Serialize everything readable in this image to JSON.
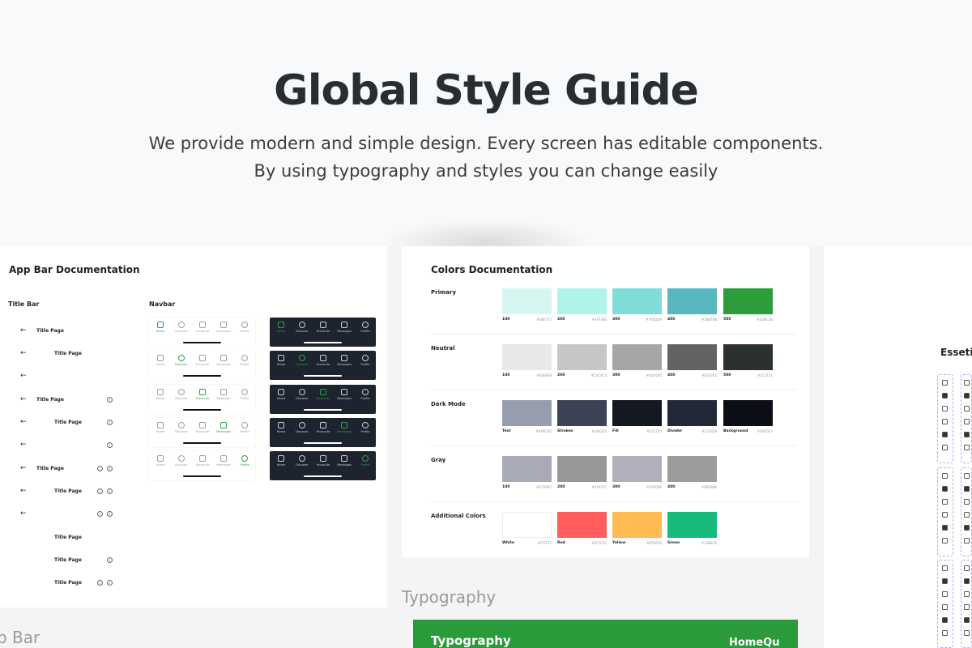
{
  "hero": {
    "title": "Global Style Guide",
    "subtitle_line1": "We provide modern and simple design. Every screen has editable components.",
    "subtitle_line2": "By using typography and styles you can change easily"
  },
  "appbar_panel": {
    "title": "App Bar Documentation",
    "titlebar_heading": "Title Bar",
    "navbar_heading": "Navbar",
    "title_rows": [
      {
        "label": "Title Page",
        "info_count": 0
      },
      {
        "label": "Title Page",
        "info_count": 0
      },
      {
        "label": "",
        "info_count": 0
      },
      {
        "label": "Title Page",
        "info_count": 1
      },
      {
        "label": "Title Page",
        "info_count": 1
      },
      {
        "label": "",
        "info_count": 1
      },
      {
        "label": "Title Page",
        "info_count": 2
      },
      {
        "label": "Title Page",
        "info_count": 2
      },
      {
        "label": "",
        "info_count": 2
      },
      {
        "label": "Title Page",
        "info_count": 0
      },
      {
        "label": "Title Page",
        "info_count": 1
      },
      {
        "label": "Title Page",
        "info_count": 2
      }
    ],
    "nav_items": [
      "Home",
      "Discover",
      "Favourite",
      "Messages",
      "Profile"
    ],
    "bottom_caption": "p Bar"
  },
  "colors_panel": {
    "title": "Colors Documentation",
    "groups": [
      {
        "name": "Primary",
        "swatches": [
          {
            "name": "100",
            "hex": "#D8F5F2",
            "color": "#d5f6f1"
          },
          {
            "name": "200",
            "hex": "#AFF3EB",
            "color": "#aff3ea"
          },
          {
            "name": "300",
            "hex": "#7FDDD9",
            "color": "#80dcd9"
          },
          {
            "name": "400",
            "hex": "#58B7B8",
            "color": "#58b6bf"
          },
          {
            "name": "500",
            "hex": "#2D9C3B",
            "color": "#2d9c3b"
          }
        ]
      },
      {
        "name": "Neutral",
        "swatches": [
          {
            "name": "100",
            "hex": "#E8E8E9",
            "color": "#e8e8e8"
          },
          {
            "name": "200",
            "hex": "#C4C4C4",
            "color": "#c6c6c6"
          },
          {
            "name": "300",
            "hex": "#A5A5A5",
            "color": "#a6a6a6"
          },
          {
            "name": "400",
            "hex": "#626262",
            "color": "#636363"
          },
          {
            "name": "500",
            "hex": "#2C3131",
            "color": "#2b3030"
          }
        ]
      },
      {
        "name": "Dark Mode",
        "swatches": [
          {
            "name": "Text",
            "hex": "#949CAD",
            "color": "#969ead"
          },
          {
            "name": "Strokes",
            "hex": "#3A4254",
            "color": "#3a4254"
          },
          {
            "name": "Fill",
            "hex": "#121720",
            "color": "#131821"
          },
          {
            "name": "Divider",
            "hex": "#232838",
            "color": "#232839"
          },
          {
            "name": "Background",
            "hex": "#0A0D14",
            "color": "#0b0e15"
          }
        ]
      },
      {
        "name": "Gray",
        "swatches": [
          {
            "name": "100",
            "hex": "#A7A9B7",
            "color": "#a8aab7"
          },
          {
            "name": "200",
            "hex": "#979797",
            "color": "#989898"
          },
          {
            "name": "300",
            "hex": "#AFB0B6",
            "color": "#afb0bb"
          },
          {
            "name": "400",
            "hex": "#9B9B9B",
            "color": "#9c9c9c"
          }
        ]
      },
      {
        "name": "Additional Colors",
        "swatches": [
          {
            "name": "White",
            "hex": "#FFFFFF",
            "color": "#ffffff"
          },
          {
            "name": "Red",
            "hex": "#FF5C5C",
            "color": "#ff5c5c"
          },
          {
            "name": "Yellow",
            "hex": "#FFBA5B",
            "color": "#ffba52"
          },
          {
            "name": "Green",
            "hex": "#13BB7B",
            "color": "#16bb7b"
          }
        ]
      }
    ]
  },
  "typography": {
    "section_caption": "Typography",
    "banner_title": "Typography",
    "logo": "HomeQu"
  },
  "right_panel": {
    "title": "Essetio"
  }
}
